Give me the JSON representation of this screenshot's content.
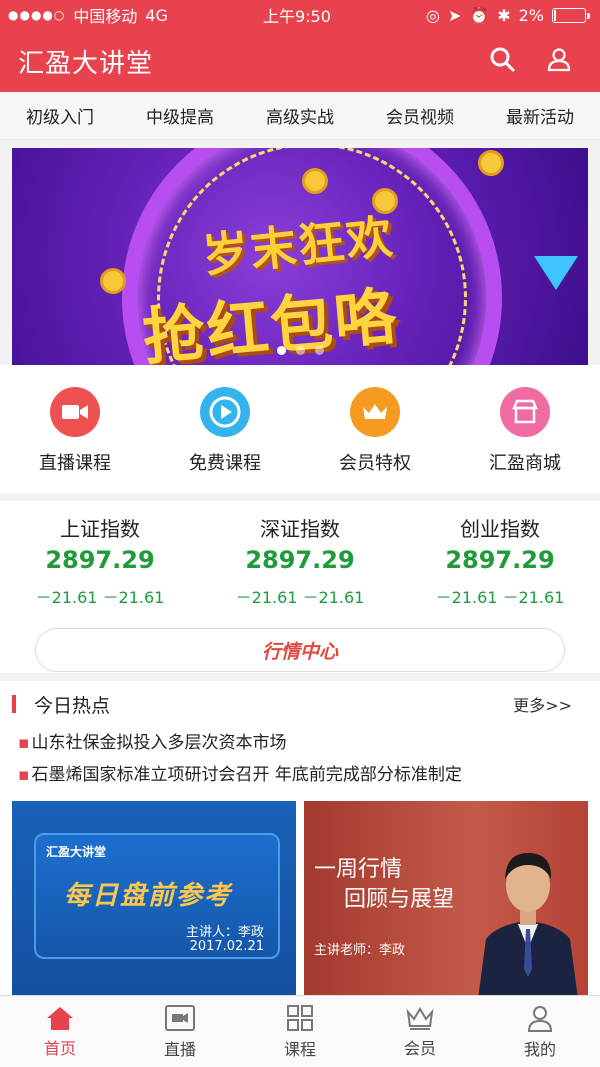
{
  "status_bar": {
    "carrier": "中国移动",
    "network": "4G",
    "time": "上午9:50",
    "battery": "2%"
  },
  "header": {
    "title": "汇盈大讲堂",
    "icons": [
      "search-icon",
      "user-icon"
    ]
  },
  "category_nav": [
    "初级入门",
    "中级提高",
    "高级实战",
    "会员视频",
    "最新活动"
  ],
  "banner": {
    "line1": "岁末狂欢",
    "line2": "抢红包咯",
    "slide_count": 3,
    "active_slide": 1
  },
  "quick_links": [
    {
      "label": "直播课程",
      "icon": "video-camera-icon",
      "color": "#ef5150"
    },
    {
      "label": "免费课程",
      "icon": "play-icon",
      "color": "#35b3ef"
    },
    {
      "label": "会员特权",
      "icon": "crown-icon",
      "color": "#f79a21"
    },
    {
      "label": "汇盈商城",
      "icon": "store-icon",
      "color": "#ef6ba1"
    }
  ],
  "market": {
    "indices": [
      {
        "name": "上证指数",
        "value": "2897.29",
        "change": "－21.61 －21.61"
      },
      {
        "name": "深证指数",
        "value": "2897.29",
        "change": "－21.61 －21.61"
      },
      {
        "name": "创业指数",
        "value": "2897.29",
        "change": "－21.61 －21.61"
      }
    ],
    "center_button": "行情中心"
  },
  "hot": {
    "title": "今日热点",
    "more": "更多>>",
    "news": [
      "山东社保金拟投入多层次资本市场",
      "石墨烯国家标准立项研讨会召开 年底前完成部分标准制定"
    ],
    "card1": {
      "brand": "汇盈大讲堂",
      "headline": "每日盘前参考",
      "speaker": "主讲人：李政",
      "date": "2017.02.21"
    },
    "card2": {
      "line1": "一周行情",
      "line2": "回顾与展望",
      "speaker": "主讲老师：李政"
    }
  },
  "tab_bar": [
    {
      "label": "首页",
      "icon": "home-icon",
      "active": true
    },
    {
      "label": "直播",
      "icon": "live-icon",
      "active": false
    },
    {
      "label": "课程",
      "icon": "grid-icon",
      "active": false
    },
    {
      "label": "会员",
      "icon": "crown-outline-icon",
      "active": false
    },
    {
      "label": "我的",
      "icon": "person-icon",
      "active": false
    }
  ],
  "colors": {
    "brand": "#e8424f",
    "up_down": "#1f9c3a"
  }
}
